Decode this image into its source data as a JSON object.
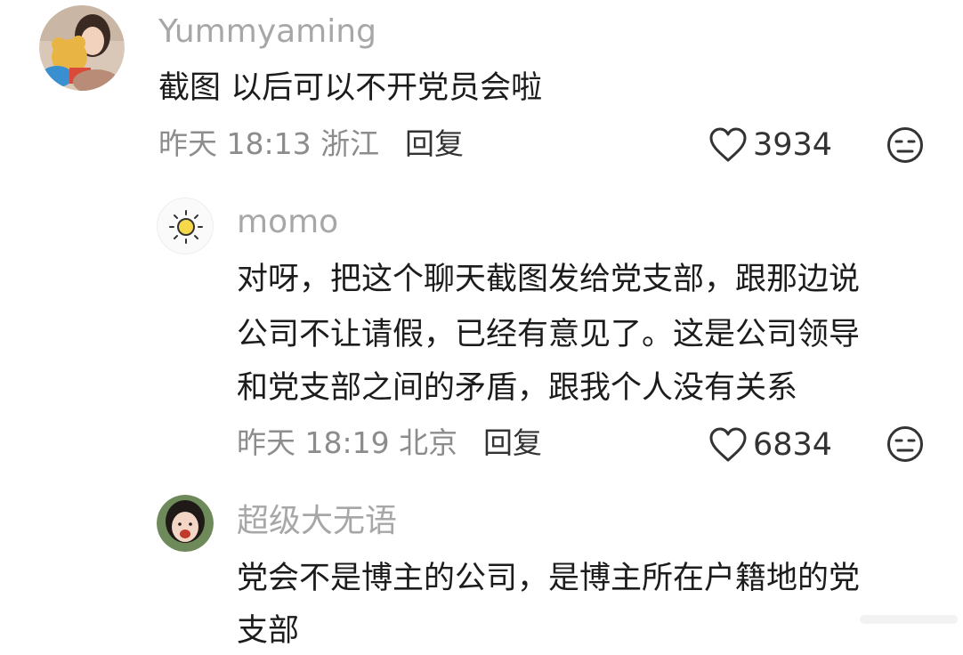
{
  "comments": [
    {
      "username": "Yummyaming",
      "text_lines": [
        "截图 以后可以不开党员会啦"
      ],
      "meta": "昨天 18:13 浙江",
      "reply_label": "回复",
      "likes": "3934",
      "avatar_icon": "avatar-photo",
      "like_icon": "heart-outline-icon",
      "dislike_icon": "meh-face-icon"
    },
    {
      "username": "momo",
      "text_lines": [
        "对呀，把这个聊天截图发给党支部，跟那边说",
        "公司不让请假，已经有意见了。这是公司领导",
        "和党支部之间的矛盾，跟我个人没有关系"
      ],
      "meta": "昨天 18:19 北京",
      "reply_label": "回复",
      "likes": "6834",
      "avatar_icon": "sun-icon",
      "like_icon": "heart-outline-icon",
      "dislike_icon": "meh-face-icon"
    },
    {
      "username": "超级大无语",
      "text_lines": [
        "党会不是博主的公司，是博主所在户籍地的党",
        "支部"
      ],
      "avatar_icon": "avatar-photo"
    }
  ],
  "colors": {
    "username": "#a7a7a7",
    "body": "#1c1c1c",
    "meta": "#8c8c8c",
    "action": "#333333"
  }
}
